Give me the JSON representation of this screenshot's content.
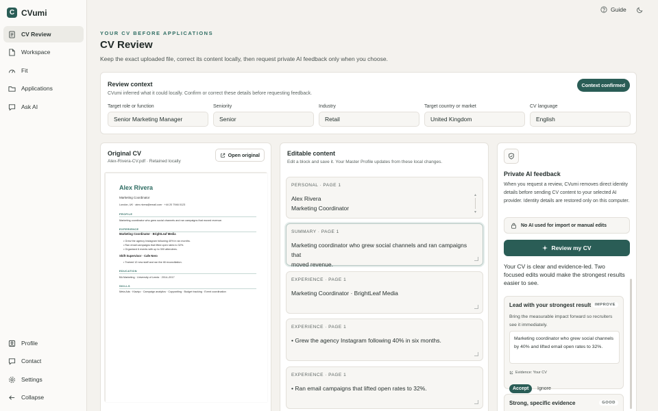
{
  "app": {
    "name": "CVumi",
    "logo_letter": "C"
  },
  "sidebar": {
    "items": [
      {
        "label": "CV Review",
        "icon": "document-icon"
      },
      {
        "label": "Workspace",
        "icon": "document-icon"
      },
      {
        "label": "Fit",
        "icon": "gauge-icon"
      },
      {
        "label": "Applications",
        "icon": "folder-icon"
      },
      {
        "label": "Ask AI",
        "icon": "chat-icon"
      }
    ],
    "bottom_items": [
      {
        "label": "Profile",
        "icon": "user-icon"
      },
      {
        "label": "Contact",
        "icon": "chat-icon"
      },
      {
        "label": "Settings",
        "icon": "gear-icon"
      },
      {
        "label": "Collapse",
        "icon": "arrow-left-icon"
      }
    ]
  },
  "topbar": {
    "guide_label": "Guide"
  },
  "header": {
    "eyebrow": "YOUR CV BEFORE APPLICATIONS",
    "title": "CV Review",
    "subtitle": "Keep the exact uploaded file, correct its content locally, then request private AI feedback only when you choose."
  },
  "context": {
    "title": "Review context",
    "subtitle": "CVumi inferred what it could locally. Confirm or correct these details before requesting feedback.",
    "confirm_label": "Context confirmed",
    "fields": [
      {
        "label": "Target role or function",
        "value": "Senior Marketing Manager"
      },
      {
        "label": "Seniority",
        "value": "Senior"
      },
      {
        "label": "Industry",
        "value": "Retail"
      },
      {
        "label": "Target country or market",
        "value": "United Kingdom"
      },
      {
        "label": "CV language",
        "value": "English"
      }
    ]
  },
  "original": {
    "title": "Original CV",
    "subtitle": "Alex-Rivera-CV.pdf · Retained locally",
    "open_label": "Open original",
    "preview": {
      "name": "Alex Rivera",
      "role": "Marketing Coordinator",
      "contact": "London, UK · alex.rivera@email.com · +44 20 7946 0123",
      "profile_head": "PROFILE",
      "profile_text": "Marketing coordinator who grew social channels and ran campaigns that moved revenue.",
      "experience_head": "EXPERIENCE",
      "job1": "Marketing Coordinator · BrightLeaf Media",
      "job1_bullets": [
        "• Grew the agency Instagram following 40% in six months.",
        "• Ran email campaigns that lifted open rates to 32%.",
        "• Organised 6 events with up to 300 attendees."
      ],
      "job2": "Shift Supervisor · Cafe Nero",
      "job2_bullets": [
        "• Trained 12 new staff and ran the till reconciliation."
      ],
      "education_head": "EDUCATION",
      "education_text": "BA Marketing · University of Leeds · 2014–2017",
      "skills_head": "SKILLS",
      "skills_text": "Meta Ads · Klaviyo · Campaign analytics · Copywriting · Budget tracking · Event coordination"
    }
  },
  "editable": {
    "title": "Editable content",
    "subtitle": "Edit a block and save it. Your Master Profile updates from these local changes.",
    "blocks": [
      {
        "tag": "PERSONAL · PAGE 1",
        "line1": "Alex Rivera",
        "line2": "Marketing Coordinator"
      },
      {
        "tag": "SUMMARY · PAGE 1",
        "line1": "Marketing coordinator who grew social channels and ran campaigns that",
        "line2": "moved revenue."
      },
      {
        "tag": "EXPERIENCE · PAGE 1",
        "line1": "Marketing Coordinator · BrightLeaf Media",
        "line2": ""
      },
      {
        "tag": "EXPERIENCE · PAGE 1",
        "line1": "• Grew the agency Instagram following 40% in six months.",
        "line2": ""
      },
      {
        "tag": "EXPERIENCE · PAGE 1",
        "line1": "• Ran email campaigns that lifted open rates to 32%.",
        "line2": ""
      }
    ]
  },
  "ai": {
    "title": "Private AI feedback",
    "description": "When you request a review, CVumi removes direct identity details before sending CV content to your selected AI provider. Identity details are restored only on this computer.",
    "no_ai_label": "No AI used for import or manual edits",
    "review_label": "Review my CV",
    "summary": "Your CV is clear and evidence-led. Two focused edits would make the strongest results easier to see.",
    "suggestions": [
      {
        "title": "Lead with your strongest result",
        "badge": "IMPROVE",
        "description": "Bring the measurable impact forward so recruiters see it immediately.",
        "quote": "Marketing coordinator who grew social channels by 40% and lifted email open rates to 32%.",
        "evidence": "Evidence: Your CV",
        "accept_label": "Accept",
        "ignore_label": "Ignore"
      },
      {
        "title": "Strong, specific evidence",
        "badge": "GOOD"
      }
    ]
  }
}
